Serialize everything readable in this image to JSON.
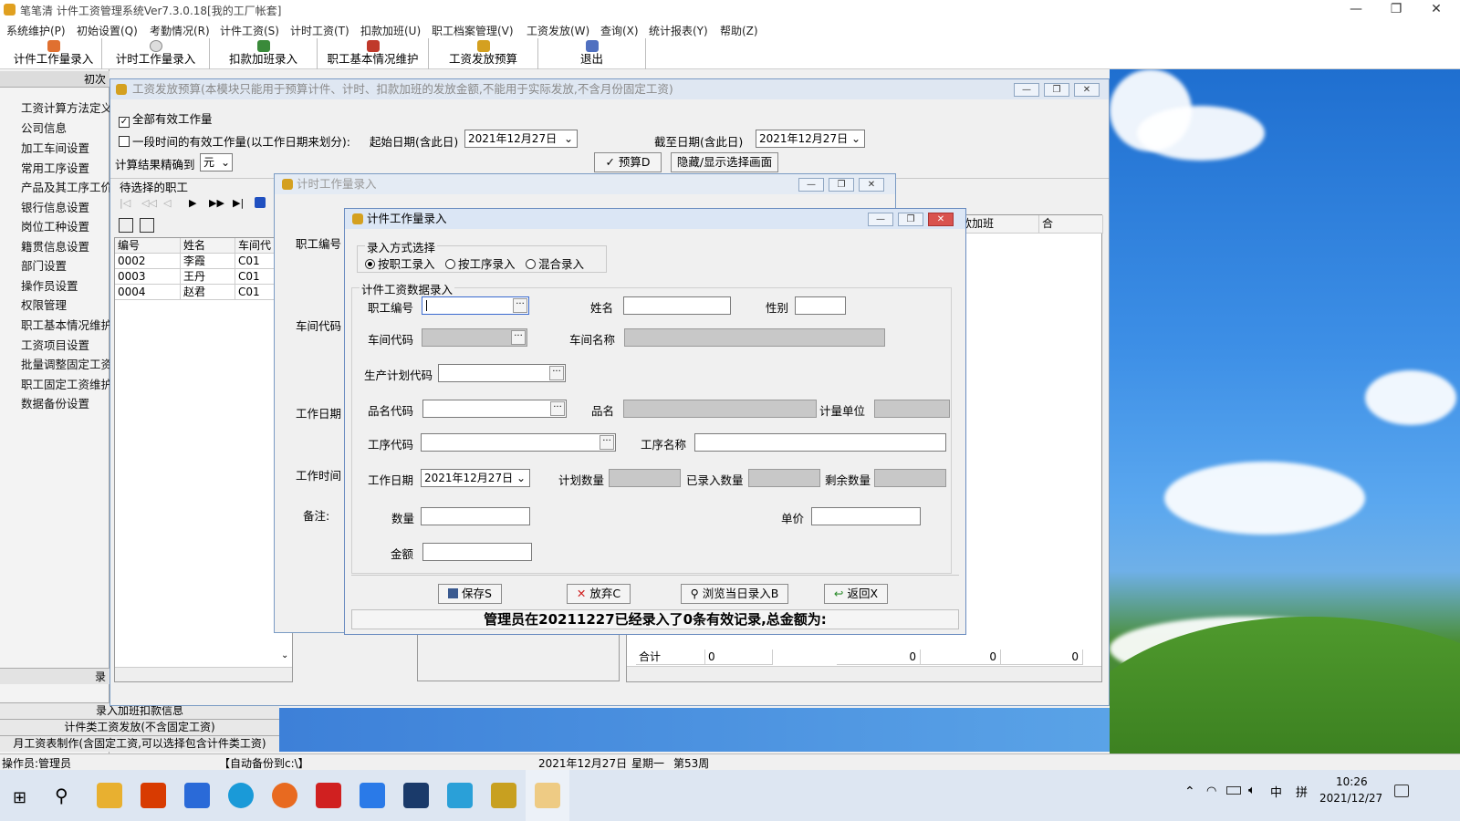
{
  "app": {
    "title": "笔笔清 计件工资管理系统Ver7.3.0.18[我的工厂帐套]"
  },
  "menu": [
    "系统维护(P)",
    "初始设置(Q)",
    "考勤情况(R)",
    "计件工资(S)",
    "计时工资(T)",
    "扣款加班(U)",
    "职工档案管理(V)",
    "工资发放(W)",
    "查询(X)",
    "统计报表(Y)",
    "帮助(Z)"
  ],
  "toolbar": [
    "计件工作量录入",
    "计时工作量录入",
    "扣款加班录入",
    "职工基本情况维护",
    "工资发放预算",
    "退出"
  ],
  "left": {
    "header_partial": "初次",
    "items": [
      "工资计算方法定义",
      "公司信息",
      "加工车间设置",
      "常用工序设置",
      "产品及其工序工价",
      "银行信息设置",
      "岗位工种设置",
      "籍贯信息设置",
      "部门设置",
      "操作员设置",
      "权限管理",
      "职工基本情况维护",
      "工资项目设置",
      "批量调整固定工资",
      "职工固定工资维护",
      "数据备份设置"
    ],
    "bottom_partial": "录",
    "bottom_nav": [
      "录入加班扣款信息",
      "计件类工资发放(不含固定工资)",
      "月工资表制作(含固定工资,可以选择包含计件类工资)"
    ]
  },
  "budget": {
    "title": "工资发放预算(本模块只能用于预算计件、计时、扣款加班的发放金额,不能用于实际发放,不含月份固定工资)",
    "all_valid": "全部有效工作量",
    "period_label": "一段时间的有效工作量(以工作日期来划分):",
    "start_label": "起始日期(含此日)",
    "start_date": "2021年12月27日",
    "end_label": "截至日期(含此日)",
    "end_date": "2021年12月27日",
    "precision_label": "计算结果精确到",
    "precision_value": "元",
    "budget_button": "预算D",
    "toggle_button": "隐藏/显示选择画面",
    "pending_label": "待选择的职工",
    "grid_headers": [
      "编号",
      "姓名",
      "车间代"
    ],
    "grid_rows": [
      [
        "0002",
        "李霞",
        "C01"
      ],
      [
        "0003",
        "王丹",
        "C01"
      ],
      [
        "0004",
        "赵君",
        "C01"
      ]
    ],
    "right_headers": [
      "扣款加班",
      "合"
    ],
    "total_label": "合计",
    "totals": [
      "0",
      "0",
      "0",
      "0"
    ]
  },
  "timed": {
    "title": "计时工作量录入",
    "labels": [
      "职工编号",
      "车间代码",
      "工作日期",
      "工作时间",
      "备注:"
    ]
  },
  "piece": {
    "title": "计件工作量录入",
    "mode_group": "录入方式选择",
    "modes": [
      "按职工录入",
      "按工序录入",
      "混合录入"
    ],
    "data_group": "计件工资数据录入",
    "employee_id_label": "职工编号",
    "name_label": "姓名",
    "gender_label": "性别",
    "workshop_code_label": "车间代码",
    "workshop_name_label": "车间名称",
    "plan_code_label": "生产计划代码",
    "product_code_label": "品名代码",
    "product_name_label": "品名",
    "unit_label": "计量单位",
    "process_code_label": "工序代码",
    "process_name_label": "工序名称",
    "work_date_label": "工作日期",
    "work_date": "2021年12月27日",
    "plan_qty_label": "计划数量",
    "entered_qty_label": "已录入数量",
    "remain_qty_label": "剩余数量",
    "qty_label": "数量",
    "price_label": "单价",
    "amount_label": "金额",
    "save": "保存S",
    "discard": "放弃C",
    "browse": "浏览当日录入B",
    "back": "返回X",
    "status_msg": "管理员在20211227已经录入了0条有效记录,总金额为:"
  },
  "statusbar": {
    "operator": "操作员:管理员",
    "backup": "【自动备份到c:\\】",
    "date": "2021年12月27日",
    "weekday": "星期一",
    "week": "第53周"
  },
  "taskbar": {
    "time": "10:26",
    "date": "2021/12/27",
    "ime1": "中",
    "ime2": "拼"
  }
}
